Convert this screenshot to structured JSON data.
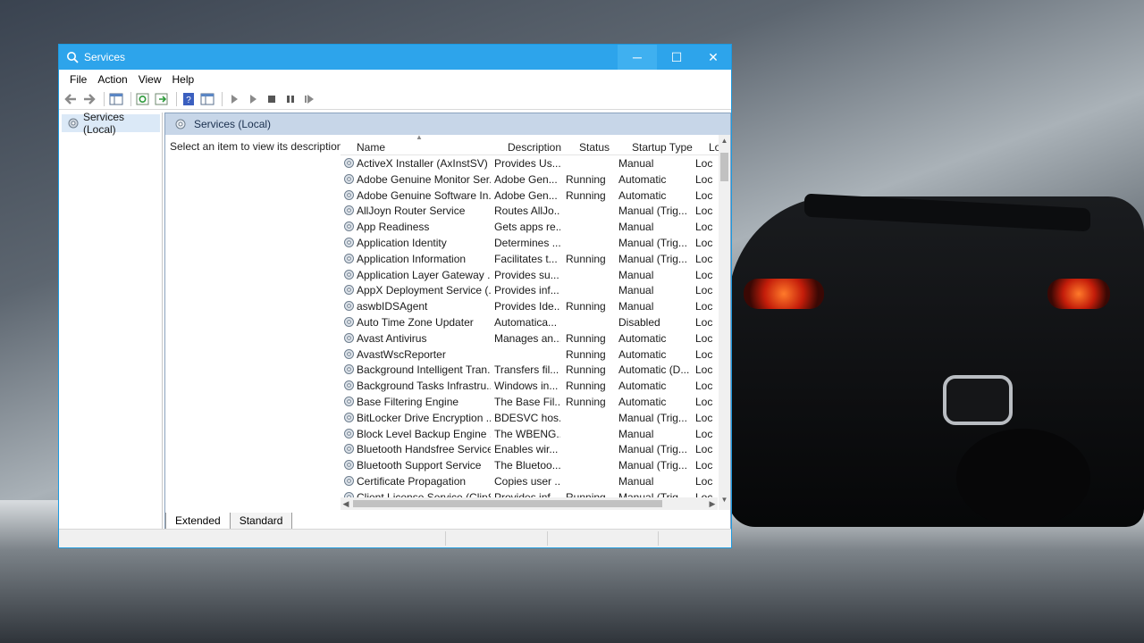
{
  "window": {
    "title": "Services",
    "controls": {
      "minimize": "─",
      "maximize": "☐",
      "close": "✕"
    }
  },
  "menu": [
    "File",
    "Action",
    "View",
    "Help"
  ],
  "toolbar": {
    "icons": [
      "back-arrow-icon",
      "forward-arrow-icon",
      "console-tree-icon",
      "refresh-icon",
      "export-list-icon",
      "help-icon",
      "properties-icon",
      "start-service-icon",
      "start-service-alt-icon",
      "stop-service-icon",
      "pause-service-icon",
      "restart-service-icon"
    ]
  },
  "tree": {
    "root": "Services (Local)"
  },
  "pane": {
    "header": "Services (Local)",
    "description_hint": "Select an item to view its description."
  },
  "list": {
    "columns": [
      "Name",
      "Description",
      "Status",
      "Startup Type",
      "Log"
    ],
    "rows": [
      [
        "ActiveX Installer (AxInstSV)",
        "Provides Us...",
        "",
        "Manual",
        "Loc"
      ],
      [
        "Adobe Genuine Monitor Ser...",
        "Adobe Gen...",
        "Running",
        "Automatic",
        "Loc"
      ],
      [
        "Adobe Genuine Software In...",
        "Adobe Gen...",
        "Running",
        "Automatic",
        "Loc"
      ],
      [
        "AllJoyn Router Service",
        "Routes AllJo...",
        "",
        "Manual (Trig...",
        "Loc"
      ],
      [
        "App Readiness",
        "Gets apps re...",
        "",
        "Manual",
        "Loc"
      ],
      [
        "Application Identity",
        "Determines ...",
        "",
        "Manual (Trig...",
        "Loc"
      ],
      [
        "Application Information",
        "Facilitates t...",
        "Running",
        "Manual (Trig...",
        "Loc"
      ],
      [
        "Application Layer Gateway ...",
        "Provides su...",
        "",
        "Manual",
        "Loc"
      ],
      [
        "AppX Deployment Service (...",
        "Provides inf...",
        "",
        "Manual",
        "Loc"
      ],
      [
        "aswbIDSAgent",
        "Provides Ide...",
        "Running",
        "Manual",
        "Loc"
      ],
      [
        "Auto Time Zone Updater",
        "Automatica...",
        "",
        "Disabled",
        "Loc"
      ],
      [
        "Avast Antivirus",
        "Manages an...",
        "Running",
        "Automatic",
        "Loc"
      ],
      [
        "AvastWscReporter",
        "",
        "Running",
        "Automatic",
        "Loc"
      ],
      [
        "Background Intelligent Tran...",
        "Transfers fil...",
        "Running",
        "Automatic (D...",
        "Loc"
      ],
      [
        "Background Tasks Infrastru...",
        "Windows in...",
        "Running",
        "Automatic",
        "Loc"
      ],
      [
        "Base Filtering Engine",
        "The Base Fil...",
        "Running",
        "Automatic",
        "Loc"
      ],
      [
        "BitLocker Drive Encryption ...",
        "BDESVC hos...",
        "",
        "Manual (Trig...",
        "Loc"
      ],
      [
        "Block Level Backup Engine ...",
        "The WBENG...",
        "",
        "Manual",
        "Loc"
      ],
      [
        "Bluetooth Handsfree Service",
        "Enables wir...",
        "",
        "Manual (Trig...",
        "Loc"
      ],
      [
        "Bluetooth Support Service",
        "The Bluetoo...",
        "",
        "Manual (Trig...",
        "Loc"
      ],
      [
        "Certificate Propagation",
        "Copies user ...",
        "",
        "Manual",
        "Loc"
      ],
      [
        "Client License Service (ClipS...",
        "Provides inf...",
        "Running",
        "Manual (Trig...",
        "Loc"
      ]
    ]
  },
  "tabs": [
    "Extended",
    "Standard"
  ]
}
